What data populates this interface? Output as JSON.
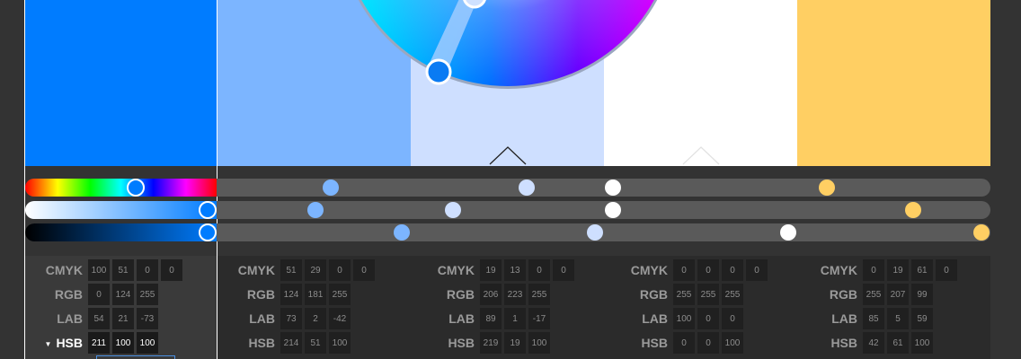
{
  "colors": {
    "swatches": [
      "#007cff",
      "#7cb5ff",
      "#cedfff",
      "#ffffff",
      "#ffcf63"
    ],
    "background": "#333333",
    "panel": "#2b2b2b",
    "track": "#5a5a5a"
  },
  "icons": {
    "color_wheel": "color-wheel-icon",
    "harmony_rule_marker": "triangle-marker-icon",
    "mode_toggle": "triangle-down-icon"
  },
  "sliders": {
    "hue": {
      "values": [
        211,
        214,
        219,
        0,
        42
      ]
    },
    "saturation": {
      "values": [
        100,
        51,
        19,
        0,
        61
      ]
    },
    "brightness": {
      "values": [
        100,
        100,
        100,
        100,
        100
      ]
    }
  },
  "label_mode": "HSB",
  "labels": [
    "CMYK",
    "RGB",
    "LAB",
    "HSB"
  ],
  "swatch_values": [
    {
      "CMYK": [
        "100",
        "51",
        "0",
        "0"
      ],
      "RGB": [
        "0",
        "124",
        "255"
      ],
      "LAB": [
        "54",
        "21",
        "-73"
      ],
      "HSB": [
        "211",
        "100",
        "100"
      ]
    },
    {
      "CMYK": [
        "51",
        "29",
        "0",
        "0"
      ],
      "RGB": [
        "124",
        "181",
        "255"
      ],
      "LAB": [
        "73",
        "2",
        "-42"
      ],
      "HSB": [
        "214",
        "51",
        "100"
      ]
    },
    {
      "CMYK": [
        "19",
        "13",
        "0",
        "0"
      ],
      "RGB": [
        "206",
        "223",
        "255"
      ],
      "LAB": [
        "89",
        "1",
        "-17"
      ],
      "HSB": [
        "219",
        "19",
        "100"
      ]
    },
    {
      "CMYK": [
        "0",
        "0",
        "0",
        "0"
      ],
      "RGB": [
        "255",
        "255",
        "255"
      ],
      "LAB": [
        "100",
        "0",
        "0"
      ],
      "HSB": [
        "0",
        "0",
        "100"
      ]
    },
    {
      "CMYK": [
        "0",
        "19",
        "61",
        "0"
      ],
      "RGB": [
        "255",
        "207",
        "99"
      ],
      "LAB": [
        "85",
        "5",
        "59"
      ],
      "HSB": [
        "42",
        "61",
        "100"
      ]
    }
  ]
}
